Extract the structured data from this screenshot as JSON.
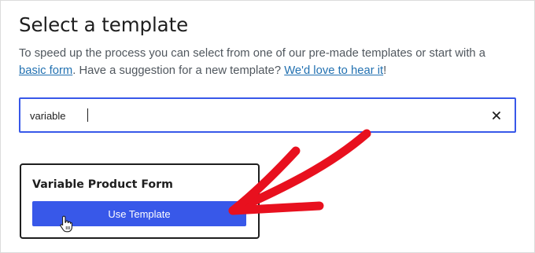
{
  "header": {
    "title": "Select a template",
    "description_prefix": "To speed up the process you can select from one of our pre-made templates or start with a ",
    "basic_form_link": "basic form",
    "description_middle": ". Have a suggestion for a new template? ",
    "suggest_link": "We'd love to hear it",
    "description_suffix": "!"
  },
  "search": {
    "value": "variable",
    "clear_icon": "close-icon"
  },
  "templates": [
    {
      "title": "Variable Product Form",
      "button_label": "Use Template"
    }
  ],
  "colors": {
    "accent": "#3858e9",
    "link": "#2271b1",
    "annotation_arrow": "#e8101e"
  }
}
